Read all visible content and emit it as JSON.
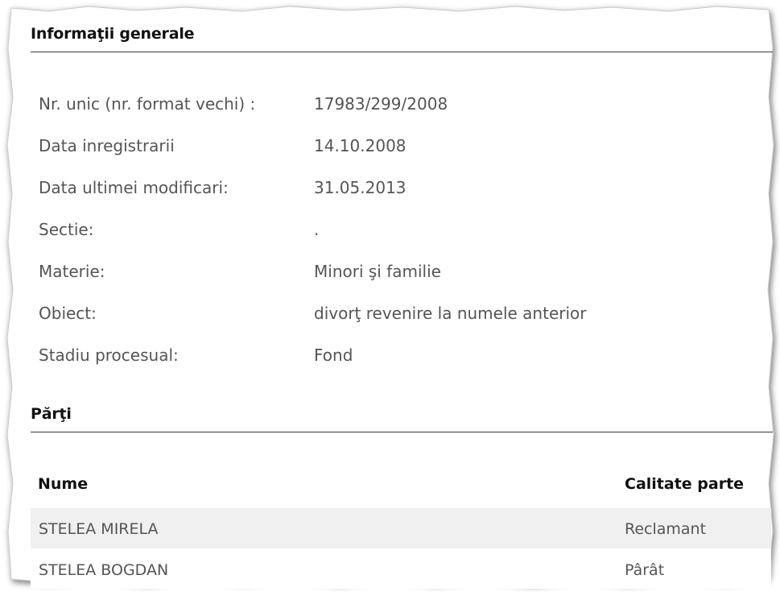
{
  "general": {
    "title": "Informaţii generale",
    "fields": [
      {
        "label": "Nr. unic (nr. format vechi) :",
        "value": "17983/299/2008"
      },
      {
        "label": "Data inregistrarii",
        "value": "14.10.2008"
      },
      {
        "label": "Data ultimei modificari:",
        "value": "31.05.2013"
      },
      {
        "label": "Sectie:",
        "value": "."
      },
      {
        "label": "Materie:",
        "value": "Minori şi familie"
      },
      {
        "label": "Obiect:",
        "value": "divorţ revenire la numele anterior"
      },
      {
        "label": "Stadiu procesual:",
        "value": "Fond"
      }
    ]
  },
  "parties": {
    "title": "Părţi",
    "columns": [
      "Nume",
      "Calitate parte"
    ],
    "rows": [
      {
        "name": "STELEA MIRELA",
        "role": "Reclamant"
      },
      {
        "name": "STELEA BOGDAN",
        "role": "Pârât"
      }
    ]
  },
  "colors": {
    "row_stripe": "#f0f0f0",
    "rule": "#3a3a3a",
    "label_text": "#555555"
  }
}
